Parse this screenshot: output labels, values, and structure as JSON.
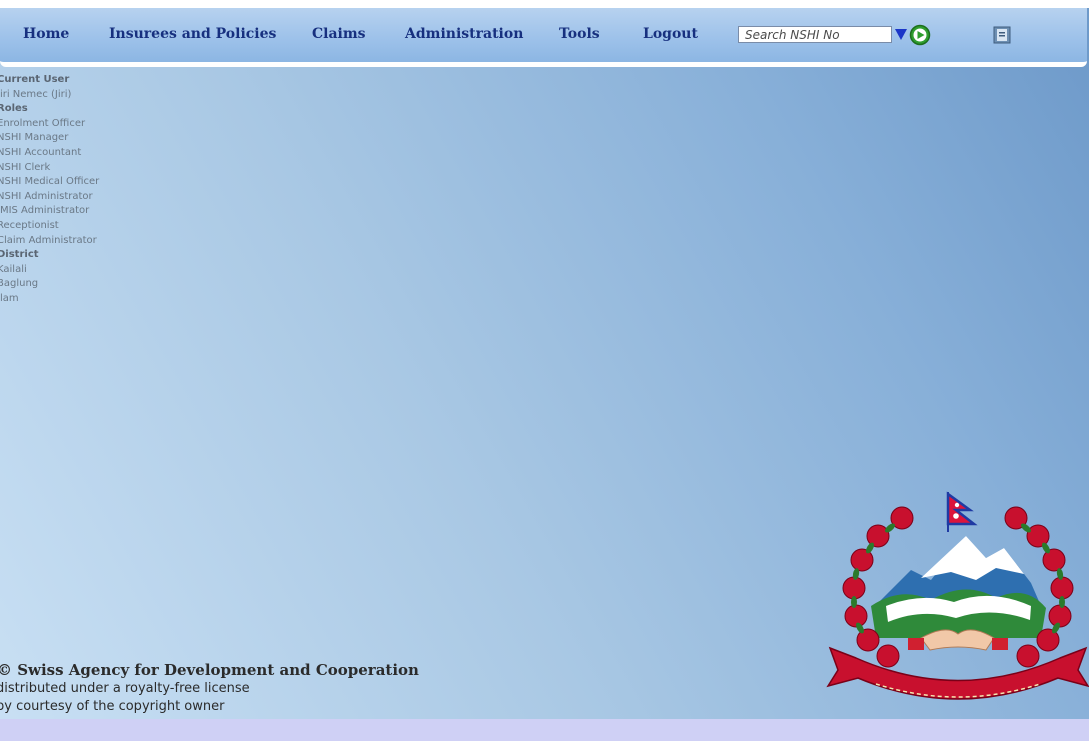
{
  "menu": {
    "home": "Home",
    "insurees": "Insurees and Policies",
    "claims": "Claims",
    "administration": "Administration",
    "tools": "Tools",
    "logout": "Logout"
  },
  "search": {
    "placeholder": "Search NSHI No"
  },
  "icons": {
    "dropdown": "triangle-down-icon",
    "go": "green-play-icon",
    "help": "help-book-icon"
  },
  "userinfo": {
    "current_user_label": "Current User",
    "current_user": "Jiri Nemec (Jiri)",
    "roles_label": "Roles",
    "roles": [
      "Enrolment Officer",
      "NSHI Manager",
      "NSHI Accountant",
      "NSHI Clerk",
      "NSHI Medical Officer",
      "NSHI Administrator",
      "IMIS Administrator",
      "Receptionist",
      "Claim Administrator"
    ],
    "district_label": "District",
    "districts": [
      "Kailali",
      "Baglung",
      "Ilam"
    ]
  },
  "footer": {
    "copyright": "© Swiss Agency for Development and Cooperation",
    "license": "distributed under a royalty-free license",
    "courtesy": "by courtesy of the copyright owner"
  },
  "colors": {
    "menu_text": "#17307f",
    "menubar": "#9ec2ea",
    "bottom_bar": "#cfd0f5",
    "dropdown_arrow": "#1b36c8",
    "go_green": "#2f9e2f"
  }
}
